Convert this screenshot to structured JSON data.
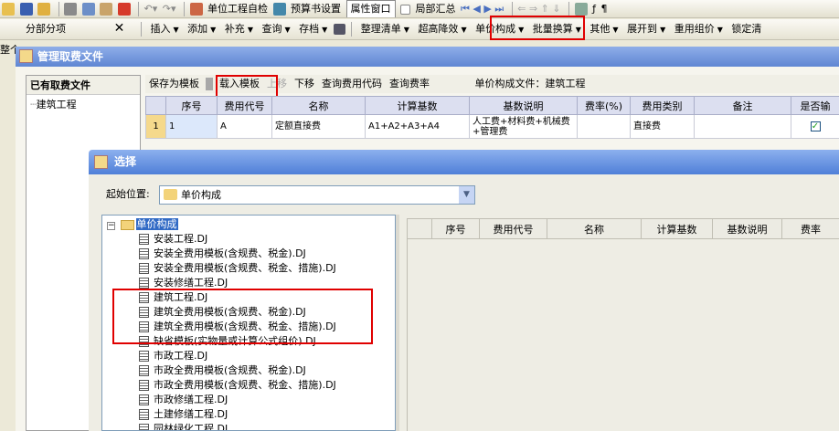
{
  "toolbar1": {
    "btn_check": "单位工程自检",
    "btn_preview": "预算书设置",
    "btn_props": "属性窗口",
    "btn_local": "局部汇总"
  },
  "toolbar2": {
    "panel_label": "分部分项",
    "menu": [
      "插入",
      "添加",
      "补充",
      "查询",
      "存档",
      "整理清单",
      "超高降效",
      "单价构成",
      "批量换算",
      "其他",
      "展开到",
      "重用组价",
      "锁定清"
    ]
  },
  "left_edge_label": "整个",
  "manager": {
    "title": "管理取费文件",
    "left_header": "已有取费文件",
    "left_item": "建筑工程",
    "toolbar": [
      "保存为模板",
      "载入模板",
      "上移",
      "下移",
      "查询费用代码",
      "查询费率"
    ],
    "file_label": "单价构成文件：建筑工程",
    "columns": [
      "",
      "序号",
      "费用代号",
      "名称",
      "计算基数",
      "基数说明",
      "费率(%)",
      "费用类别",
      "备注",
      "是否输"
    ],
    "rows": [
      {
        "idx": "1",
        "seq": "1",
        "code": "A",
        "name": "定额直接费",
        "base": "A1+A2+A3+A4",
        "base_desc": "人工费+材料费+机械费+管理费",
        "rate": "",
        "category": "直接费",
        "note": ""
      }
    ]
  },
  "dialog": {
    "title": "选择",
    "start_label": "起始位置:",
    "start_value": "单价构成",
    "tree_root": "单价构成",
    "tree_items": [
      "安装工程.DJ",
      "安装全费用模板(含规费、税金).DJ",
      "安装全费用模板(含规费、税金、措施).DJ",
      "安装修缮工程.DJ",
      "建筑工程.DJ",
      "建筑全费用模板(含规费、税金).DJ",
      "建筑全费用模板(含规费、税金、措施).DJ",
      "缺省模板(实物量或计算公式组价).DJ",
      "市政工程.DJ",
      "市政全费用模板(含规费、税金).DJ",
      "市政全费用模板(含规费、税金、措施).DJ",
      "市政修缮工程.DJ",
      "土建修缮工程.DJ",
      "园林绿化工程.DJ"
    ],
    "columns": [
      "",
      "序号",
      "费用代号",
      "名称",
      "计算基数",
      "基数说明",
      "费率"
    ]
  },
  "colors": {
    "highlight": "#e00000",
    "title_blue": "#5f86d3"
  }
}
